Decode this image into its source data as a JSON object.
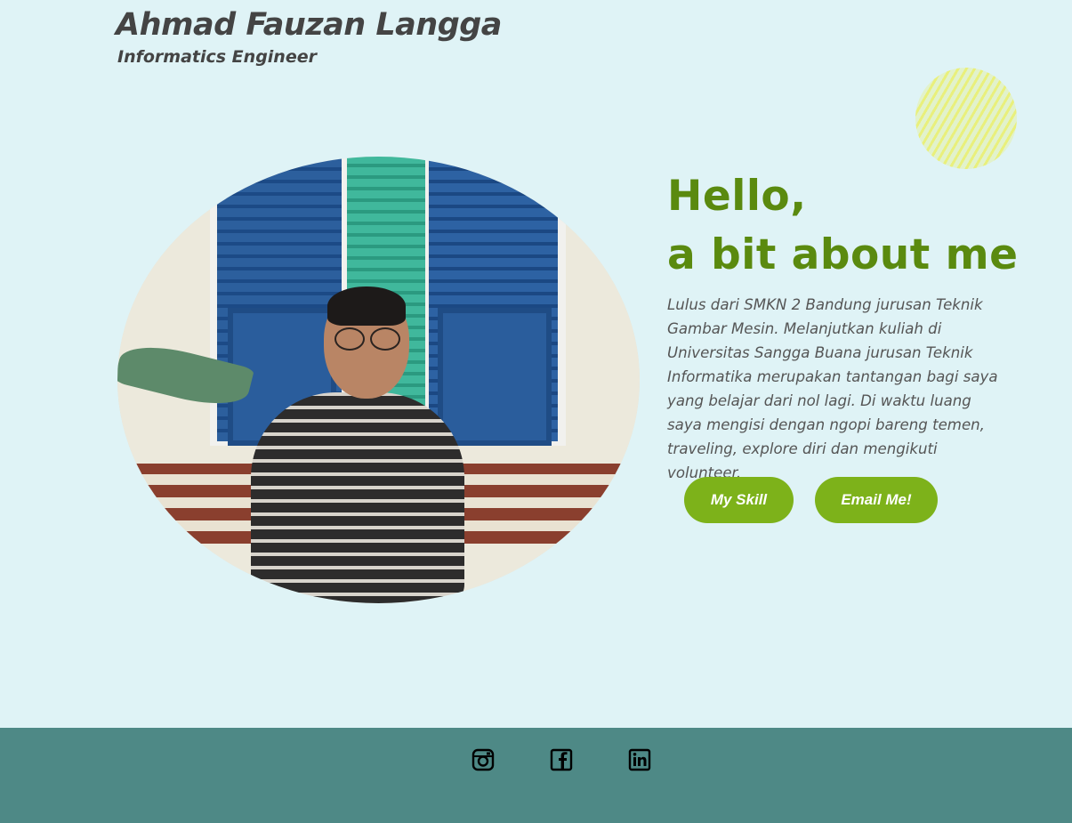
{
  "header": {
    "name": "Ahmad Fauzan Langga",
    "role": "Informatics Engineer"
  },
  "about": {
    "title_line1": "Hello,",
    "title_line2": "a bit about me",
    "text": "Lulus dari SMKN 2 Bandung jurusan Teknik Gambar Mesin. Melanjutkan kuliah di Universitas Sangga Buana jurusan Teknik Informatika merupakan tantangan bagi saya yang belajar dari nol lagi. Di waktu luang saya mengisi dengan ngopi bareng temen, traveling, explore diri dan mengikuti volunteer."
  },
  "buttons": {
    "skill_label": "My Skill",
    "email_label": "Email Me!"
  },
  "footer": {
    "icons": [
      "instagram-icon",
      "facebook-icon",
      "linkedin-icon"
    ]
  },
  "colors": {
    "background": "#dff3f6",
    "accent_green": "#7db21a",
    "title_green": "#5a8a0f",
    "footer": "#4e8986",
    "deco_yellow": "#e9f07c"
  }
}
